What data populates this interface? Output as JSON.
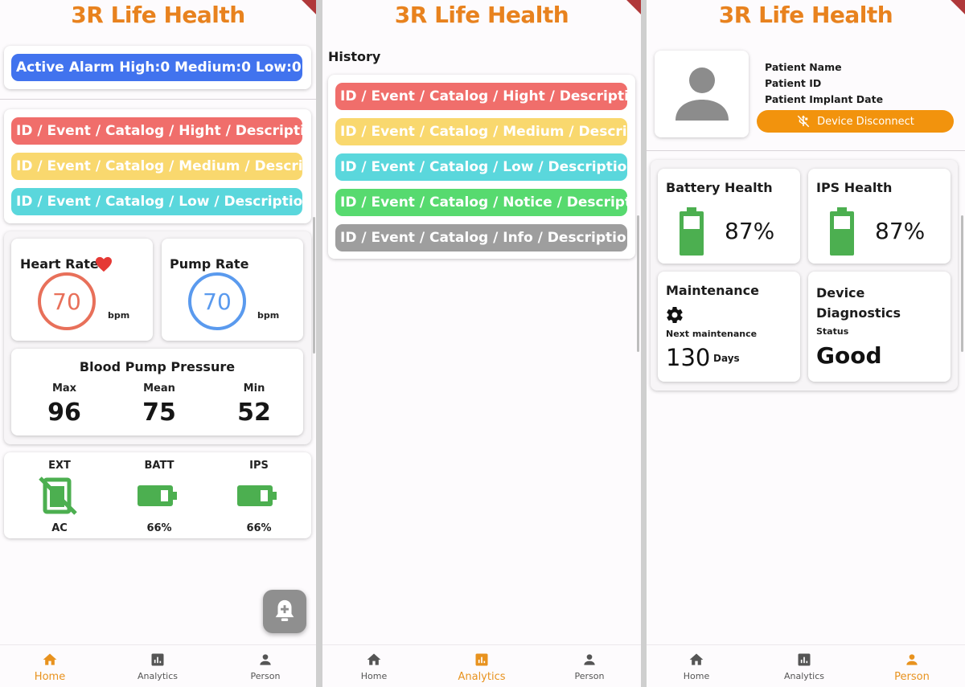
{
  "app": {
    "title": "3R Life Health"
  },
  "home": {
    "active_alarm": "Active Alarm  High:0  Medium:0  Low:0",
    "alarms": [
      "ID / Event / Catalog /  Hight / Description",
      "ID / Event / Catalog /  Medium / Description",
      "ID / Event / Catalog /  Low / Description"
    ],
    "heart_rate": {
      "label": "Heart Rate",
      "value": "70",
      "unit": "bpm"
    },
    "pump_rate": {
      "label": "Pump Rate",
      "value": "70",
      "unit": "bpm"
    },
    "pressure": {
      "title": "Blood Pump Pressure",
      "max_label": "Max",
      "max": "96",
      "mean_label": "Mean",
      "mean": "75",
      "min_label": "Min",
      "min": "52"
    },
    "power": {
      "ext_label": "EXT",
      "ext_value": "AC",
      "batt_label": "BATT",
      "batt_value": "66%",
      "ips_label": "IPS",
      "ips_value": "66%"
    }
  },
  "analytics": {
    "history_label": "History",
    "items": [
      "ID / Event / Catalog /  Hight / Description",
      "ID / Event / Catalog /  Medium / Description",
      "ID / Event / Catalog /  Low / Description",
      "ID / Event / Catalog /  Notice / Description",
      "ID / Event / Catalog /  Info / Description"
    ]
  },
  "person": {
    "patient_name": "Patient Name",
    "patient_id": "Patient ID",
    "implant_date": "Patient Implant Date",
    "disconnect_label": "Device Disconnect",
    "battery_health_label": "Battery Health",
    "battery_health_value": "87%",
    "ips_health_label": "IPS Health",
    "ips_health_value": "87%",
    "maintenance_label": "Maintenance",
    "next_maintenance_label": "Next maintenance",
    "next_maintenance_value": "130",
    "next_maintenance_unit": "Days",
    "diagnostics_label": "Device Diagnostics",
    "status_label": "Status",
    "status_value": "Good"
  },
  "nav": {
    "home": "Home",
    "analytics": "Analytics",
    "person": "Person"
  },
  "colors": {
    "accent": "#e8821e",
    "alarm_blue": "#4173ee",
    "high": "#f06e6b",
    "medium": "#f9d86e",
    "low": "#5ad7dc",
    "notice": "#57da6f",
    "info": "#9e9e9e",
    "battery": "#4caf50"
  },
  "icons": [
    "heart-icon",
    "ac-off-icon",
    "battery-icon",
    "bell-plus-icon",
    "home-icon",
    "analytics-icon",
    "person-icon",
    "avatar-icon",
    "usb-off-icon",
    "gear-icon"
  ]
}
